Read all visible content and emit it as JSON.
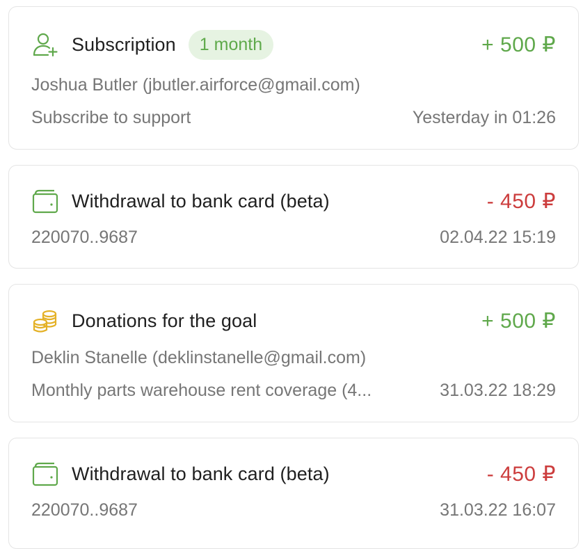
{
  "colors": {
    "positive": "#5fa84b",
    "negative": "#cc3d3d",
    "coins": "#e4b126"
  },
  "transactions": [
    {
      "icon": "user-plus-icon",
      "title": "Subscription",
      "badge": "1 month",
      "amount": "+ 500 ₽",
      "amount_type": "positive",
      "contact": "Joshua Butler (jbutler.airforce@gmail.com)",
      "description": "Subscribe to support",
      "time": "Yesterday in 01:26"
    },
    {
      "icon": "wallet-icon",
      "title": "Withdrawal to bank card (beta)",
      "amount": "- 450 ₽",
      "amount_type": "negative",
      "card": "220070..9687",
      "time": "02.04.22 15:19"
    },
    {
      "icon": "coins-icon",
      "title": "Donations for the goal",
      "amount": "+ 500 ₽",
      "amount_type": "positive",
      "contact": "Deklin Stanelle (deklinstanelle@gmail.com)",
      "description": "Monthly parts warehouse rent coverage (4...",
      "time": "31.03.22 18:29"
    },
    {
      "icon": "wallet-icon",
      "title": "Withdrawal to bank card (beta)",
      "amount": "- 450 ₽",
      "amount_type": "negative",
      "card": "220070..9687",
      "time": "31.03.22 16:07"
    }
  ]
}
